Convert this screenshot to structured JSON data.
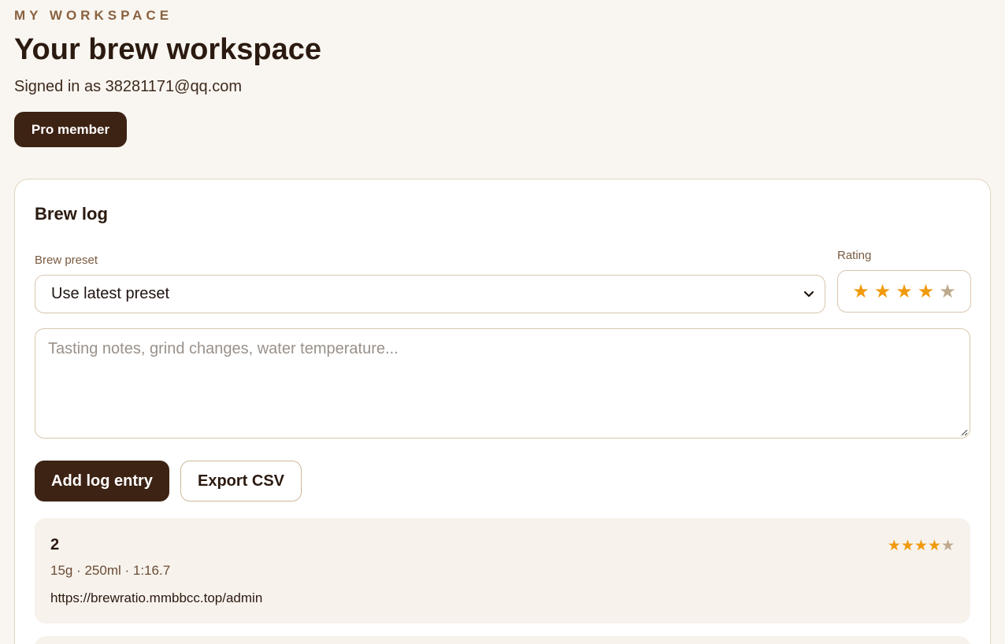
{
  "header": {
    "eyebrow": "MY WORKSPACE",
    "title": "Your brew workspace",
    "signed_in": "Signed in as 38281171@qq.com",
    "badge": "Pro member"
  },
  "brew_log": {
    "title": "Brew log",
    "preset_label": "Brew preset",
    "preset_value": "Use latest preset",
    "rating_label": "Rating",
    "rating": 4,
    "rating_max": 5,
    "notes_placeholder": "Tasting notes, grind changes, water temperature...",
    "add_button": "Add log entry",
    "export_button": "Export CSV",
    "star_color": "#f09a0e",
    "star_off_color": "#bda98d",
    "entries": [
      {
        "title": "2",
        "meta": "15g · 250ml · 1:16.7",
        "note": "https://brewratio.mmbbcc.top/admin",
        "rating": 4
      },
      {
        "title": "",
        "meta": "",
        "note": "",
        "rating": 0
      }
    ]
  }
}
